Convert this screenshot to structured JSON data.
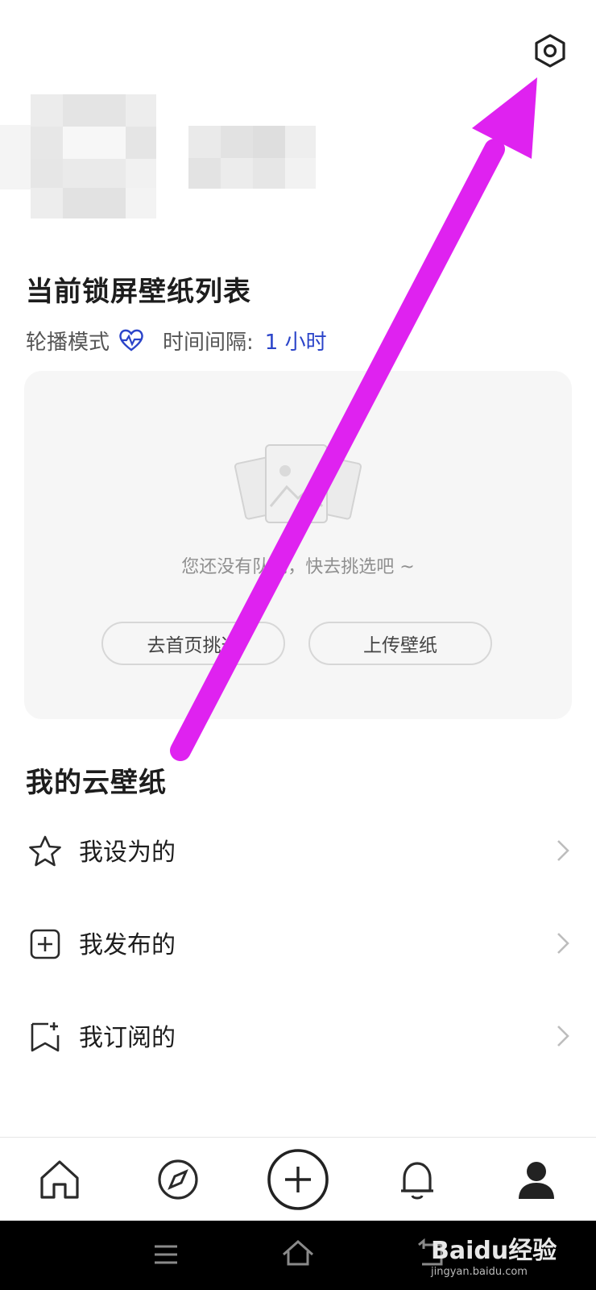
{
  "top_bar": {
    "settings_icon": "hexagon-gear-icon"
  },
  "profile": {
    "avatar": "blurred-avatar",
    "name": "blurred-name"
  },
  "lock_wallpaper": {
    "title": "当前锁屏壁纸列表",
    "mode_label": "轮播模式",
    "mode_icon": "heart-pulse-icon",
    "interval_label": "时间间隔:",
    "interval_value": "1 小时",
    "empty_text": "您还没有队列，快去挑选吧 ~",
    "pick_button": "去首页挑选",
    "upload_button": "上传壁纸"
  },
  "cloud": {
    "title": "我的云壁纸",
    "items": [
      {
        "label": "我设为的",
        "icon": "star-icon"
      },
      {
        "label": "我发布的",
        "icon": "plus-square-icon"
      },
      {
        "label": "我订阅的",
        "icon": "bookmark-plus-icon"
      }
    ]
  },
  "tabbar": {
    "tabs": [
      "home-icon",
      "compass-icon",
      "add-icon",
      "bell-icon",
      "profile-icon"
    ],
    "active": "profile-icon"
  },
  "system_nav": [
    "menu-icon",
    "home-outline-icon",
    "back-icon"
  ],
  "watermark": {
    "text": "Baidu经验",
    "sub": "jingyan.baidu.com"
  },
  "colors": {
    "accent": "#2b44c9",
    "annotation_arrow": "#df22f0"
  }
}
